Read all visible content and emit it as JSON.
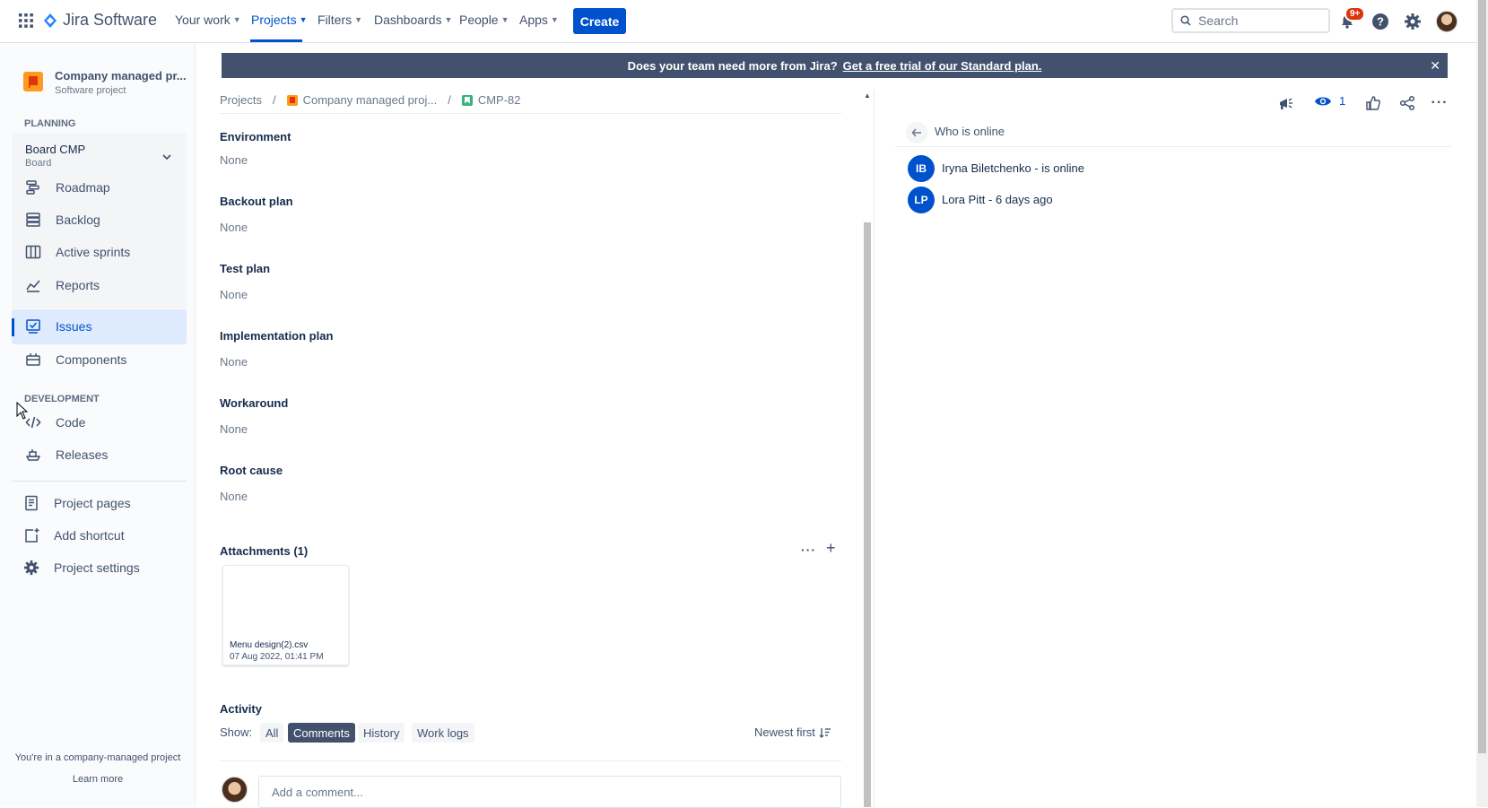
{
  "brand": {
    "name": "Jira Software"
  },
  "topnav": {
    "items": [
      {
        "label": "Your work"
      },
      {
        "label": "Projects"
      },
      {
        "label": "Filters"
      },
      {
        "label": "Dashboards"
      },
      {
        "label": "People"
      },
      {
        "label": "Apps"
      }
    ],
    "create_label": "Create",
    "search_placeholder": "Search",
    "notification_badge": "9+",
    "accent_color": "#0052cc"
  },
  "sidebar": {
    "project_name": "Company managed pr...",
    "project_type": "Software project",
    "planning_heading": "PLANNING",
    "board_name": "Board CMP",
    "board_sub": "Board",
    "planning_items": [
      {
        "label": "Roadmap",
        "icon": "roadmap-icon"
      },
      {
        "label": "Backlog",
        "icon": "backlog-icon"
      },
      {
        "label": "Active sprints",
        "icon": "columns-icon"
      },
      {
        "label": "Reports",
        "icon": "chart-line-icon"
      }
    ],
    "issues_label": "Issues",
    "components_label": "Components",
    "development_heading": "DEVELOPMENT",
    "code_label": "Code",
    "releases_label": "Releases",
    "project_pages_label": "Project pages",
    "add_shortcut_label": "Add shortcut",
    "project_settings_label": "Project settings",
    "footer_text": "You're in a company-managed project",
    "learn_more": "Learn more"
  },
  "banner": {
    "text": "Does your team need more from Jira?",
    "link": "Get a free trial of our Standard plan."
  },
  "breadcrumb": {
    "projects": "Projects",
    "project": "Company managed proj...",
    "issue": "CMP-82",
    "separator": "/"
  },
  "fields": [
    {
      "label": "Environment",
      "value": "None"
    },
    {
      "label": "Backout plan",
      "value": "None"
    },
    {
      "label": "Test plan",
      "value": "None"
    },
    {
      "label": "Implementation plan",
      "value": "None"
    },
    {
      "label": "Workaround",
      "value": "None"
    },
    {
      "label": "Root cause",
      "value": "None"
    }
  ],
  "attachments": {
    "heading": "Attachments (1)",
    "file_name": "Menu design(2).csv",
    "file_date": "07 Aug 2022, 01:41 PM"
  },
  "activity": {
    "heading": "Activity",
    "show_label": "Show:",
    "filters": [
      "All",
      "Comments",
      "History",
      "Work logs"
    ],
    "selected_filter": "Comments",
    "sort_label": "Newest first",
    "comment_placeholder": "Add a comment..."
  },
  "right_panel": {
    "watch_count": "1",
    "who_online_title": "Who is online",
    "users": [
      {
        "initials": "IB",
        "text": "Iryna Biletchenko - is online"
      },
      {
        "initials": "LP",
        "text": "Lora Pitt - 6 days ago"
      }
    ]
  }
}
